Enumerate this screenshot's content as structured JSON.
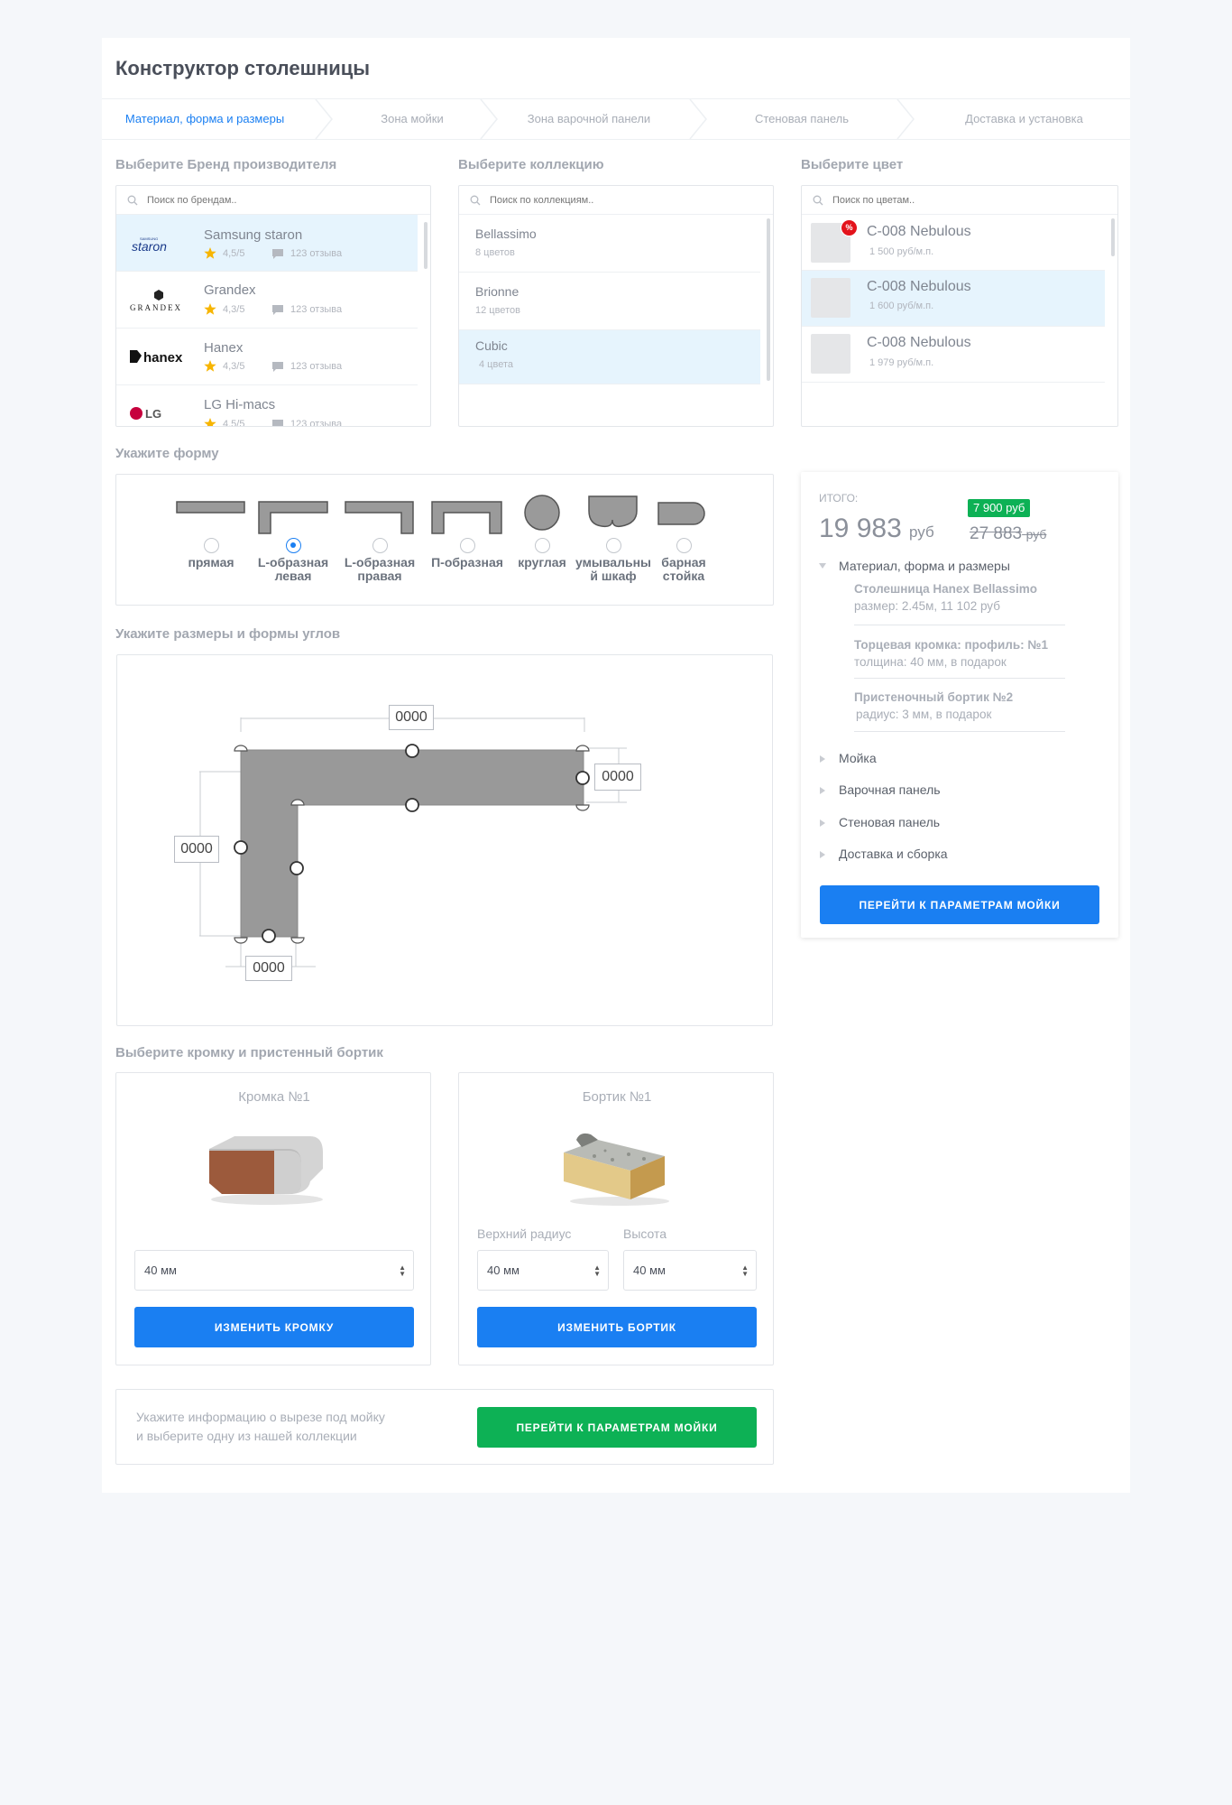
{
  "page_title": "Конструктор столешницы",
  "steps": [
    {
      "label": "Материал, форма и размеры",
      "active": true
    },
    {
      "label": "Зона мойки",
      "active": false
    },
    {
      "label": "Зона варочной панели",
      "active": false
    },
    {
      "label": "Стеновая панель",
      "active": false
    },
    {
      "label": "Доставка и установка",
      "active": false
    }
  ],
  "brand": {
    "label": "Выберите Бренд производителя",
    "placeholder": "Поиск по брендам..",
    "items": [
      {
        "name": "Samsung staron",
        "rating": "4,5/5",
        "reviews": "123 отзыва",
        "logo": "staron",
        "selected": true
      },
      {
        "name": "Grandex",
        "rating": "4,3/5",
        "reviews": "123 отзыва",
        "logo": "GRANDEX",
        "selected": false
      },
      {
        "name": "Hanex",
        "rating": "4,3/5",
        "reviews": "123 отзыва",
        "logo": "hanex",
        "selected": false
      },
      {
        "name": "LG Hi-macs",
        "rating": "4,5/5",
        "reviews": "123 отзыва",
        "logo": "LG",
        "selected": false
      }
    ]
  },
  "collection": {
    "label": "Выберите коллекцию",
    "placeholder": "Поиск по коллекциям..",
    "items": [
      {
        "name": "Bellassimo",
        "count": "8 цветов",
        "selected": false
      },
      {
        "name": "Brionne",
        "count": "12 цветов",
        "selected": false
      },
      {
        "name": "Cubic",
        "count": "4 цвета",
        "selected": true
      }
    ]
  },
  "color": {
    "label": "Выберите цвет",
    "placeholder": "Поиск по цветам..",
    "items": [
      {
        "name": "C-008 Nebulous",
        "price": "1 500 руб/м.п.",
        "sale_badge": "%",
        "selected": false
      },
      {
        "name": "C-008 Nebulous",
        "price": "1 600 руб/м.п.",
        "selected": true
      },
      {
        "name": "C-008 Nebulous",
        "price": "1 979 руб/м.п.",
        "selected": false
      }
    ]
  },
  "shape": {
    "label": "Укажите форму",
    "options": [
      {
        "label": "прямая",
        "selected": false
      },
      {
        "label": "L-образная левая",
        "selected": true
      },
      {
        "label": "L-образная правая",
        "selected": false
      },
      {
        "label": "П-образная",
        "selected": false
      },
      {
        "label": "круглая",
        "selected": false
      },
      {
        "label": "умывальный шкаф",
        "selected": false
      },
      {
        "label": "барная стойка",
        "selected": false
      }
    ],
    "option_lines": [
      [
        "прямая"
      ],
      [
        "L-образная",
        "левая"
      ],
      [
        "L-образная",
        "правая"
      ],
      [
        "П-образная"
      ],
      [
        "круглая"
      ],
      [
        "умывальны",
        "й шкаф"
      ],
      [
        "барная",
        "стойка"
      ]
    ]
  },
  "dimensions": {
    "label": "Укажите размеры и формы углов",
    "top": "0000",
    "right": "0000",
    "left": "0000",
    "bottom": "0000"
  },
  "edge_section": {
    "label": "Выберите кромку и пристенный бортик",
    "edge": {
      "title": "Кромка №1",
      "value": "40 мм",
      "button": "ИЗМЕНИТЬ КРОМКУ"
    },
    "border": {
      "title": "Бортик №1",
      "radius_label": "Верхний радиус",
      "radius_value": "40 мм",
      "height_label": "Высота",
      "height_value": "40 мм",
      "button": "ИЗМЕНИТЬ БОРТИК"
    }
  },
  "bottom_bar": {
    "text_line1": "Укажите информацию о вырезе под мойку",
    "text_line2": "и выберите одну из нашей коллекции",
    "button": "ПЕРЕЙТИ К ПАРАМЕТРАМ МОЙКИ"
  },
  "summary": {
    "total_label": "ИТОГО:",
    "total": "19 983",
    "currency": "руб",
    "discount_badge": "7 900 руб",
    "old_price": "27 883",
    "old_currency": "руб",
    "section_open": "Материал, форма и размеры",
    "details": [
      {
        "title": "Столешница Hanex Bellassimo",
        "sub": "размер: 2.45м,  11 102 руб"
      },
      {
        "title": "Торцевая кромка: профиль: №1",
        "sub": "толщина: 40 мм, в подарок"
      },
      {
        "title": "Пристеночный бортик №2",
        "sub": "радиус: 3 мм, в подарок"
      }
    ],
    "sections": [
      "Мойка",
      "Варочная панель",
      "Стеновая панель",
      "Доставка и сборка"
    ],
    "button": "ПЕРЕЙТИ К ПАРАМЕТРАМ МОЙКИ"
  },
  "colors": {
    "accent": "#1a7ff2",
    "green": "#0db155",
    "selected_row": "#e6f4fd",
    "sale": "#e3131b"
  }
}
